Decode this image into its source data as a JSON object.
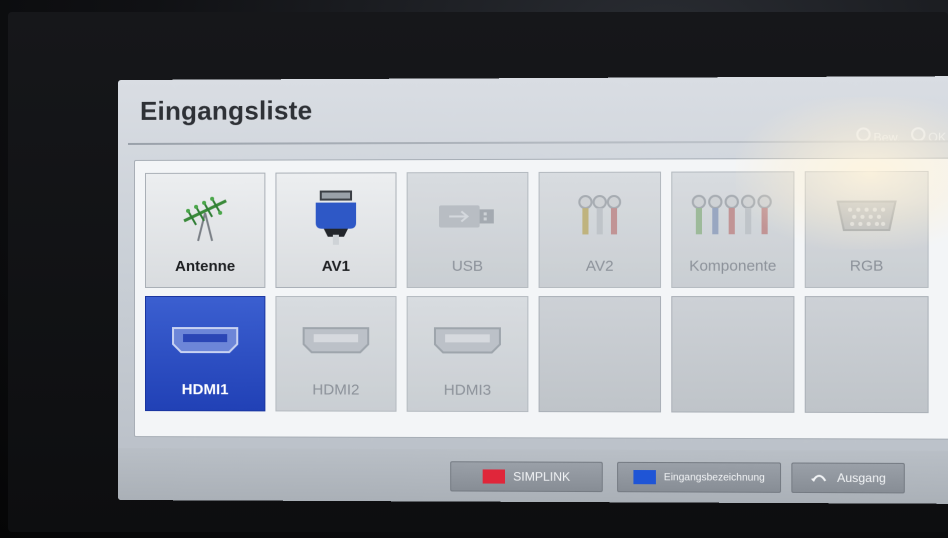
{
  "window": {
    "title": "Eingangsliste",
    "hint_move": "Bew.",
    "hint_ok": "OK"
  },
  "inputs": [
    {
      "label": "Antenne",
      "icon": "antenna-icon",
      "state": "active"
    },
    {
      "label": "AV1",
      "icon": "scart-icon",
      "state": "active"
    },
    {
      "label": "USB",
      "icon": "usb-icon",
      "state": "disabled"
    },
    {
      "label": "AV2",
      "icon": "rca-composite-icon",
      "state": "disabled"
    },
    {
      "label": "Komponente",
      "icon": "rca-component-icon",
      "state": "disabled"
    },
    {
      "label": "RGB",
      "icon": "vga-icon",
      "state": "disabled"
    },
    {
      "label": "HDMI1",
      "icon": "hdmi-icon",
      "state": "selected"
    },
    {
      "label": "HDMI2",
      "icon": "hdmi-icon",
      "state": "disabled"
    },
    {
      "label": "HDMI3",
      "icon": "hdmi-icon",
      "state": "disabled"
    }
  ],
  "footer": {
    "simplink_label": "SIMPLINK",
    "simplink_color": "#e0263a",
    "rename_label": "Eingangsbezeichnung",
    "rename_color": "#1f55d6",
    "exit_label": "Ausgang"
  },
  "colors": {
    "selected_tile": "#2a47be"
  }
}
